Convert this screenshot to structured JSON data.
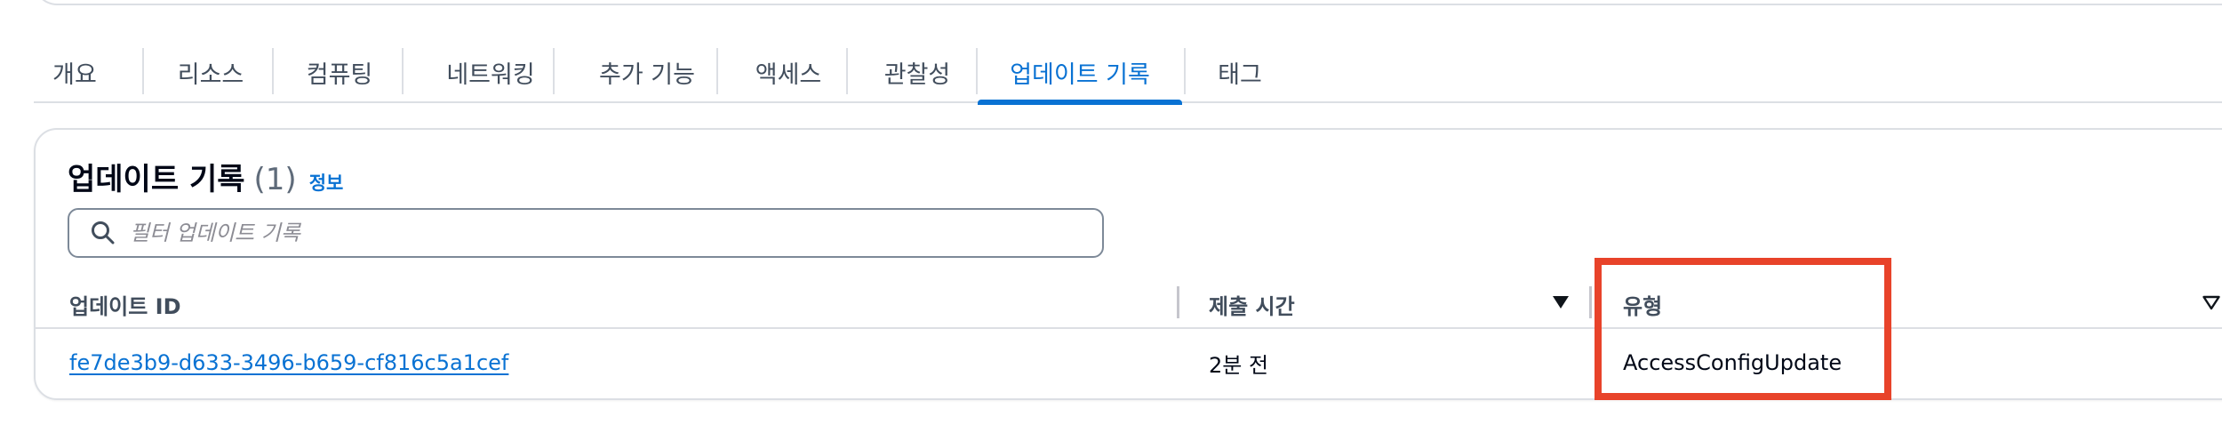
{
  "tabs": [
    {
      "label": "개요",
      "active": false
    },
    {
      "label": "리소스",
      "active": false
    },
    {
      "label": "컴퓨팅",
      "active": false
    },
    {
      "label": "네트워킹",
      "active": false
    },
    {
      "label": "추가 기능",
      "active": false
    },
    {
      "label": "액세스",
      "active": false
    },
    {
      "label": "관찰성",
      "active": false
    },
    {
      "label": "업데이트 기록",
      "active": true
    },
    {
      "label": "태그",
      "active": false
    }
  ],
  "panel": {
    "title": "업데이트 기록",
    "count": "(1)",
    "info_link": "정보",
    "filter": {
      "placeholder": "필터 업데이트 기록",
      "value": ""
    }
  },
  "table": {
    "columns": [
      {
        "label": "업데이트 ID",
        "sortable": false
      },
      {
        "label": "제출 시간",
        "sortable": true,
        "sort_icon": "caret-down-filled-icon"
      },
      {
        "label": "유형",
        "sortable": true,
        "sort_icon": "caret-down-outline-icon"
      }
    ],
    "rows": [
      {
        "update_id": "fe7de3b9-d633-3496-b659-cf816c5a1cef",
        "submitted": "2분 전",
        "type": "AccessConfigUpdate"
      }
    ]
  },
  "colors": {
    "accent": "#0972d3",
    "highlight": "#e8432a",
    "border": "#dcdfe4",
    "text": "#000716",
    "muted_text": "#414d5c"
  }
}
